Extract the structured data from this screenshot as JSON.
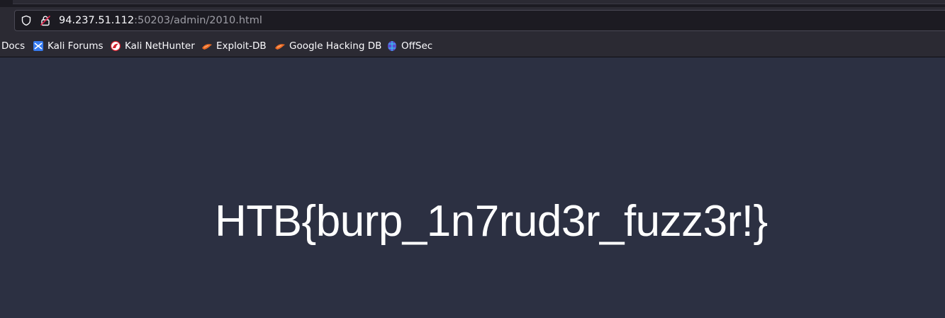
{
  "address_bar": {
    "host": "94.237.51.112",
    "path": ":50203/admin/2010.html",
    "shield_icon": "shield-icon",
    "lock_icon": "insecure-lock-icon"
  },
  "bookmarks": [
    {
      "label": "Docs",
      "icon": "none"
    },
    {
      "label": "Kali Forums",
      "icon": "kali-forums-icon"
    },
    {
      "label": "Kali NetHunter",
      "icon": "nethunter-icon"
    },
    {
      "label": "Exploit-DB",
      "icon": "exploit-db-icon"
    },
    {
      "label": "Google Hacking DB",
      "icon": "ghdb-icon"
    },
    {
      "label": "OffSec",
      "icon": "offsec-icon"
    }
  ],
  "page": {
    "flag_text": "HTB{burp_1n7rud3r_fuzz3r!}",
    "background": "#2c3042",
    "text_color": "#ffffff"
  }
}
